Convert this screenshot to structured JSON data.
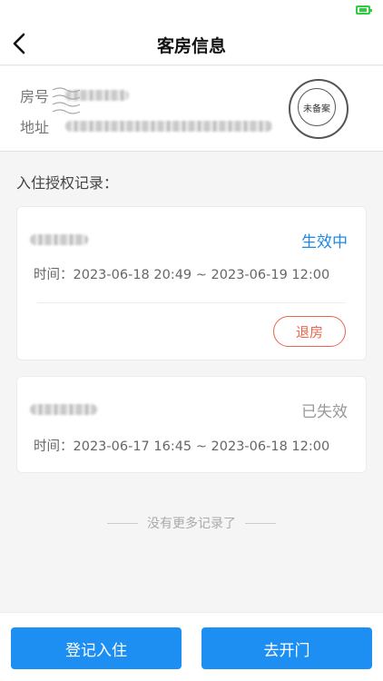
{
  "header": {
    "title": "客房信息"
  },
  "room": {
    "number_label": "房号",
    "address_label": "地址",
    "stamp_text": "未备案"
  },
  "records": {
    "section_title": "入住授权记录：",
    "items": [
      {
        "status": "生效中",
        "time": "时间：2023-06-18 20:49 ~ 2023-06-19 12:00",
        "action": "退房"
      },
      {
        "status": "已失效",
        "time": "时间：2023-06-17 16:45 ~ 2023-06-18 12:00"
      }
    ],
    "end_text": "没有更多记录了"
  },
  "footer": {
    "checkin_label": "登记入住",
    "open_door_label": "去开门"
  },
  "colors": {
    "accent": "#1e8ff2",
    "active": "#1e88e5",
    "checkout": "#e8664b",
    "battery": "#2ecc40"
  }
}
